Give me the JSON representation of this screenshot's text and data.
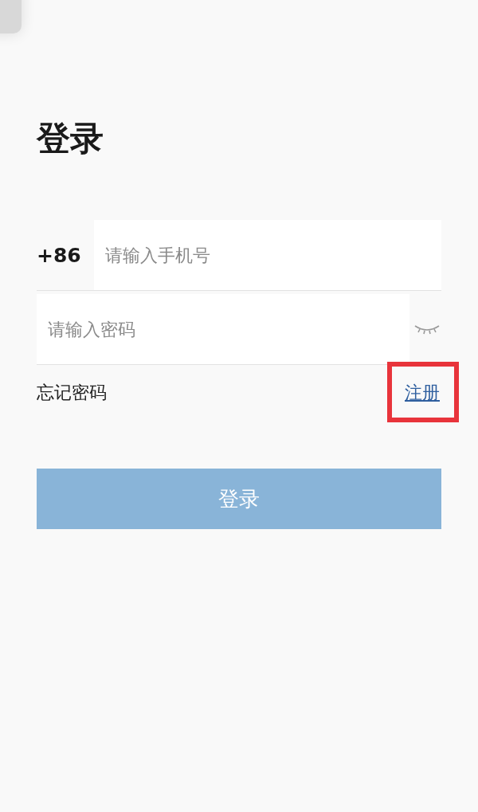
{
  "title": "登录",
  "phone": {
    "country_code": "+86",
    "placeholder": "请输入手机号"
  },
  "password": {
    "placeholder": "请输入密码",
    "visible": false
  },
  "forgot_link": "忘记密码",
  "register_link": {
    "label": "注册",
    "highlighted": true
  },
  "submit_button": {
    "label": "登录",
    "disabled": true
  }
}
